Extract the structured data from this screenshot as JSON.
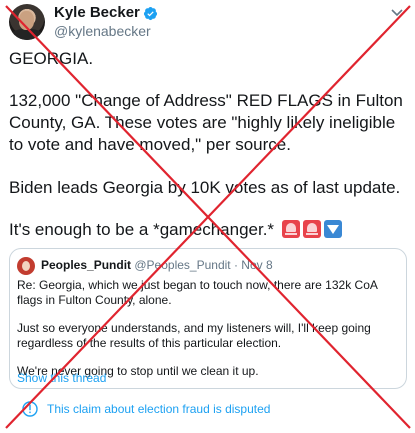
{
  "author": {
    "name": "Kyle Becker",
    "handle": "@kylenabecker"
  },
  "tweet": {
    "paragraphs": [
      "GEORGIA.",
      "132,000 \"Change of Address\" RED FLAGS in Fulton County, GA. These votes are \"highly likely ineligible to vote and have moved,\" per source.",
      "Biden leads Georgia by 10K votes as of last update.",
      "It's enough to be a *gamechanger.*"
    ],
    "trailing_emojis": [
      "siren-icon",
      "siren-icon",
      "down-arrow-icon"
    ]
  },
  "quoted_tweet": {
    "name": "Peoples_Pundit",
    "meta": "@Peoples_Pundit · Nov 8",
    "paragraphs": [
      "Re: Georgia, which we just began to touch now, there are 132k CoA flags in Fulton County, alone.",
      "Just so everyone understands, and my listeners will, I'll keep going regardless of the results of this particular election.",
      "We're never going to stop until we clean it up."
    ],
    "show_thread": "Show this thread"
  },
  "notice": {
    "text": "This claim about election fraud is disputed"
  },
  "colors": {
    "link": "#1da1f2",
    "overlay_cross": "#e0242f",
    "muted": "#657786",
    "border": "#ccd6dd"
  }
}
